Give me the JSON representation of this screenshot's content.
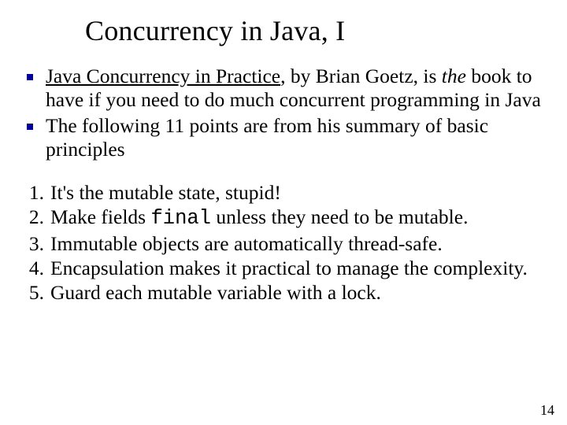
{
  "title": "Concurrency in Java, I",
  "bullets": {
    "b1": {
      "book": "Java Concurrency in Practice",
      "mid1": ", by Brian Goetz, is ",
      "the": "the",
      "rest": " book to have if you need to do much concurrent programming in Java"
    },
    "b2": "The following 11 points are from his summary of basic principles"
  },
  "numbered": {
    "n1": {
      "num": "1.",
      "text": "It's the mutable state, stupid!"
    },
    "n2": {
      "num": "2.",
      "pre": "Make fields ",
      "code": "final",
      "post": " unless they need to be mutable."
    },
    "n3": {
      "num": "3.",
      "text": "Immutable objects are automatically thread-safe."
    },
    "n4": {
      "num": "4.",
      "text": "Encapsulation makes it practical to manage the complexity."
    },
    "n5": {
      "num": "5.",
      "text": "Guard each mutable variable with a lock."
    }
  },
  "page": "14"
}
